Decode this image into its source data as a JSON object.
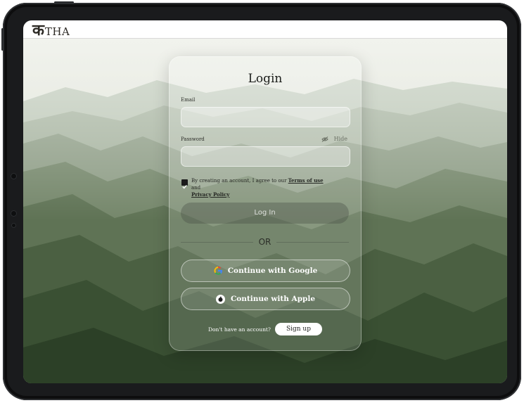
{
  "app": {
    "logo_mark": "क",
    "logo_text": "THA"
  },
  "login": {
    "title": "Login",
    "email_label": "Email",
    "email_value": "",
    "password_label": "Password",
    "password_value": "",
    "hide_label": "Hide",
    "agree_checked": true,
    "terms_prefix": "By creating an account, I agree to our ",
    "terms_link": "Terms of use",
    "terms_and": " and",
    "privacy_link": "Privacy Policy",
    "login_button": "Log In",
    "or_text": "OR",
    "google_button": "Continue with Google",
    "apple_button": "Continue with Apple",
    "no_account_text": "Don't have an account?",
    "signup_button": "Sign up"
  },
  "icons": {
    "eye_off": "eye-off-icon",
    "google": "google-icon",
    "apple": "apple-icon",
    "check": "check-icon"
  },
  "colors": {
    "device_frame": "#1a1b1d",
    "sky": "#e9ebe2",
    "mountain_dark": "#2f4a2a",
    "mountain_mid": "#5f7a59",
    "card_glass": "rgba(255,255,255,0.14)"
  }
}
